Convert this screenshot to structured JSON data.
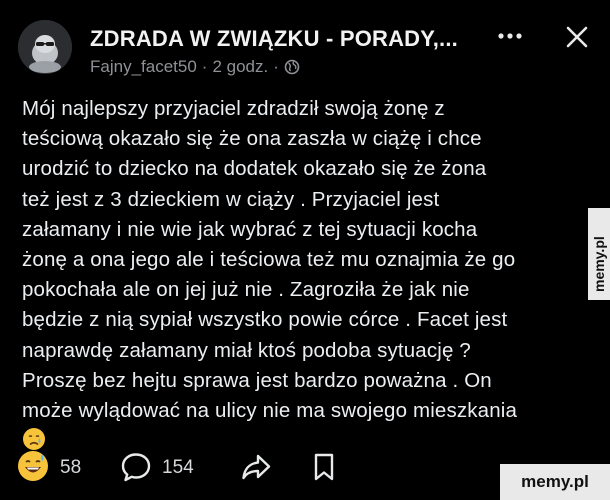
{
  "header": {
    "title": "ZDRADA W ZWIĄZKU - PORADY,...",
    "author": "Fajny_facet50",
    "separator": "·",
    "time": "2 godz.",
    "icons": {
      "more": "more-dots-icon",
      "close": "close-icon",
      "visibility": "globe-icon",
      "avatar": "avatar-image"
    }
  },
  "post": {
    "lines": [
      "Mój najlepszy przyjaciel zdradził swoją żonę z",
      "teściową okazało się że ona zaszła w ciążę i chce",
      "urodzić to dziecko na dodatek okazało się że żona",
      "też jest z 3 dzieckiem w ciąży . Przyjaciel jest",
      "załamany i nie wie jak wybrać z tej sytuacji kocha",
      "żonę a ona jego ale i teściowa też mu oznajmia że go",
      "pokochała ale on jej już nie . Zagroziła że jak nie",
      "będzie z nią sypiał wszystko powie córce . Facet jest",
      "naprawdę załamany miał ktoś podoba sytuację ?",
      "Proszę bez hejtu sprawa jest bardzo poważna . On",
      "może wylądować na ulicy nie ma swojego mieszkania"
    ],
    "trailing_emoji": "crying-face-emoji"
  },
  "actions": {
    "reaction_emoji": "grinning-sweat-emoji",
    "reactions_count": "58",
    "comment_icon": "comment-bubble-icon",
    "comments_count": "154",
    "share_icon": "share-arrow-icon",
    "save_icon": "bookmark-icon"
  },
  "watermark": {
    "side": "memy.pl",
    "bottom": "memy.pl"
  },
  "colors": {
    "background": "#000000",
    "text": "#eceff2",
    "muted": "#8e9196",
    "watermark_bg": "#e9e9e9"
  }
}
